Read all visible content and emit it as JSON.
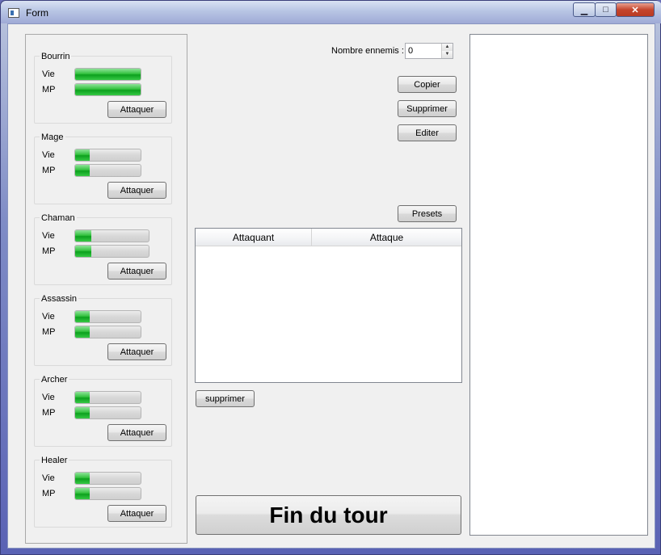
{
  "window": {
    "title": "Form",
    "icon": "app-window-icon",
    "controls": {
      "minimize": "▁",
      "maximize": "□",
      "close": "✕"
    }
  },
  "characters": [
    {
      "name": "Bourrin",
      "vie_label": "Vie",
      "mp_label": "MP",
      "vie": 1.0,
      "mp": 1.0,
      "attack_label": "Attaquer"
    },
    {
      "name": "Mage",
      "vie_label": "Vie",
      "mp_label": "MP",
      "vie": 0.22,
      "mp": 0.22,
      "attack_label": "Attaquer"
    },
    {
      "name": "Chaman",
      "vie_label": "Vie",
      "mp_label": "MP",
      "vie": 0.22,
      "mp": 0.22,
      "attack_label": "Attaquer"
    },
    {
      "name": "Assassin",
      "vie_label": "Vie",
      "mp_label": "MP",
      "vie": 0.22,
      "mp": 0.22,
      "attack_label": "Attaquer"
    },
    {
      "name": "Archer",
      "vie_label": "Vie",
      "mp_label": "MP",
      "vie": 0.22,
      "mp": 0.22,
      "attack_label": "Attaquer"
    },
    {
      "name": "Healer",
      "vie_label": "Vie",
      "mp_label": "MP",
      "vie": 0.22,
      "mp": 0.22,
      "attack_label": "Attaquer"
    }
  ],
  "enemies": {
    "label": "Nombre ennemis :",
    "value": "0",
    "copy_label": "Copier",
    "delete_label": "Supprimer",
    "edit_label": "Editer",
    "presets_label": "Presets"
  },
  "attack_table": {
    "columns": [
      "Attaquant",
      "Attaque"
    ],
    "rows": []
  },
  "remove_label": "supprimer",
  "end_turn_label": "Fin du tour",
  "colors": {
    "bar_fill": "#22b832",
    "panel_bg": "#f0f0f0"
  }
}
